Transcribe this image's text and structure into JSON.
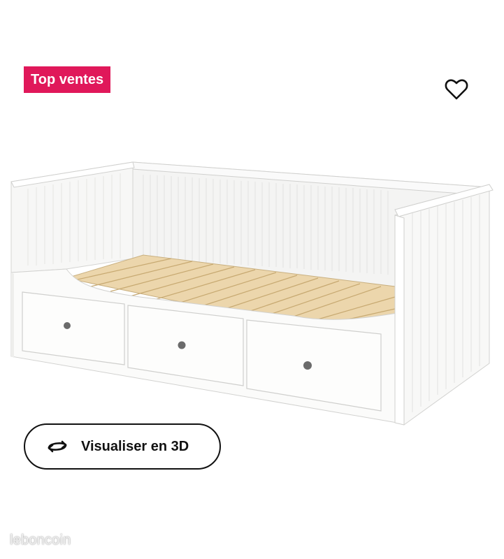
{
  "badge": {
    "label": "Top ventes",
    "color": "#e0185a"
  },
  "favorite": {
    "icon": "heart-outline-icon"
  },
  "product_image": {
    "subject": "white daybed with three drawers and wooden slats"
  },
  "view3d_button": {
    "label": "Visualiser en 3D",
    "icon": "rotate-3d-icon"
  },
  "watermark": {
    "text": "leboncoin"
  }
}
